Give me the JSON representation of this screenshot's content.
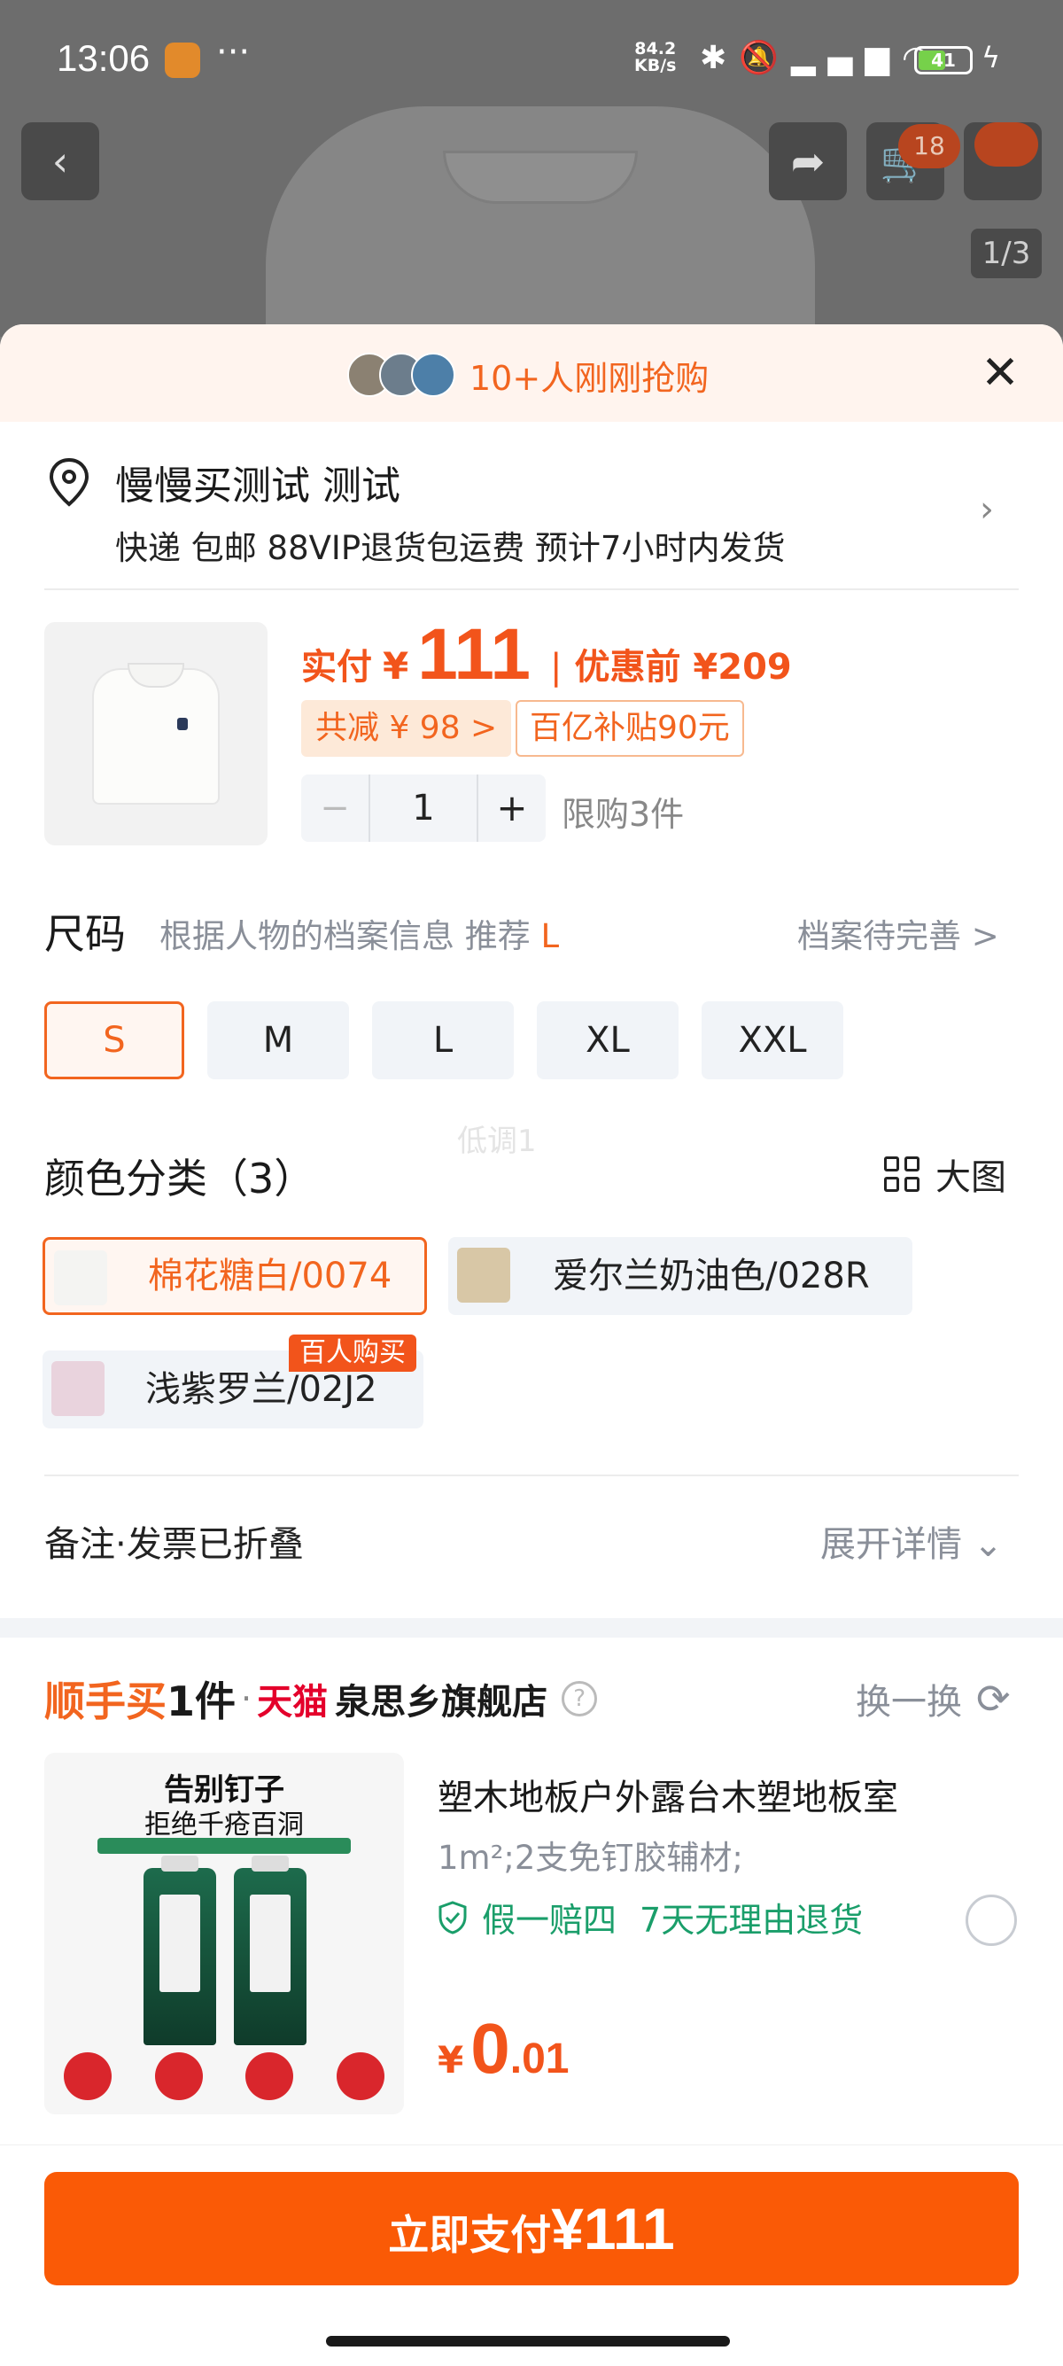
{
  "status_bar": {
    "time": "13:06",
    "dots": "···",
    "net_speed_value": "84.2",
    "net_speed_unit": "KB/s",
    "battery": "41"
  },
  "top_bar": {
    "cart_count": "18",
    "pager": "1/3"
  },
  "sheet": {
    "rush_text": "10+人刚刚抢购",
    "address": {
      "name": "慢慢买测试 测试",
      "shipping": "快递 包邮 88VIP退货包运费 预计7小时内发货"
    },
    "product": {
      "pay_label": "实付",
      "currency": "¥",
      "pay_price": "111",
      "sep": "|",
      "orig_label": "优惠前",
      "orig_price": "¥209",
      "discount_tag": "共减 ¥ 98 >",
      "subsidy_tag": "百亿补贴90元",
      "qty_minus": "−",
      "qty": "1",
      "qty_plus": "+",
      "limit": "限购3件"
    },
    "size": {
      "title": "尺码",
      "hint_prefix": "根据人物的档案信息 推荐",
      "hint_size": "L",
      "profile_link": "档案待完善 >",
      "options": [
        "S",
        "M",
        "L",
        "XL",
        "XXL"
      ],
      "selected": "S"
    },
    "watermark": "低调1",
    "color": {
      "title": "颜色分类（3）",
      "big_image": "大图",
      "options": [
        "棉花糖白/0074",
        "爱尔兰奶油色/028R",
        "浅紫罗兰/02J2"
      ],
      "hot_badge": "百人购买",
      "swatches": [
        "#f4f4f2",
        "#d8c7a6",
        "#e9d3dd"
      ]
    },
    "notes": {
      "label": "备注·发票已折叠",
      "expand": "展开详情"
    },
    "bundle": {
      "title_a": "顺手买",
      "title_b": "1件",
      "dot": "·",
      "tmall": "天猫",
      "store": "泉思乡旗舰店",
      "help": "?",
      "swap": "换一换",
      "image_title": "告别钉子",
      "image_subtitle": "拒绝千疮百洞",
      "item_name": "塑木地板户外露台木塑地板室",
      "item_spec": "1m²;2支免钉胶辅材;",
      "guarantee_1": "假一赔四",
      "guarantee_2": "7天无理由退货",
      "price_currency": "¥",
      "price_int": "0",
      "price_dec": ".01"
    },
    "pay_button": {
      "label": "立即支付",
      "amount": "¥111"
    }
  },
  "colors": {
    "accent": "#f2651f",
    "pay_button": "#fa5a06",
    "tmall_red": "#e4002b",
    "guarantee_green": "#1a9e6a"
  }
}
